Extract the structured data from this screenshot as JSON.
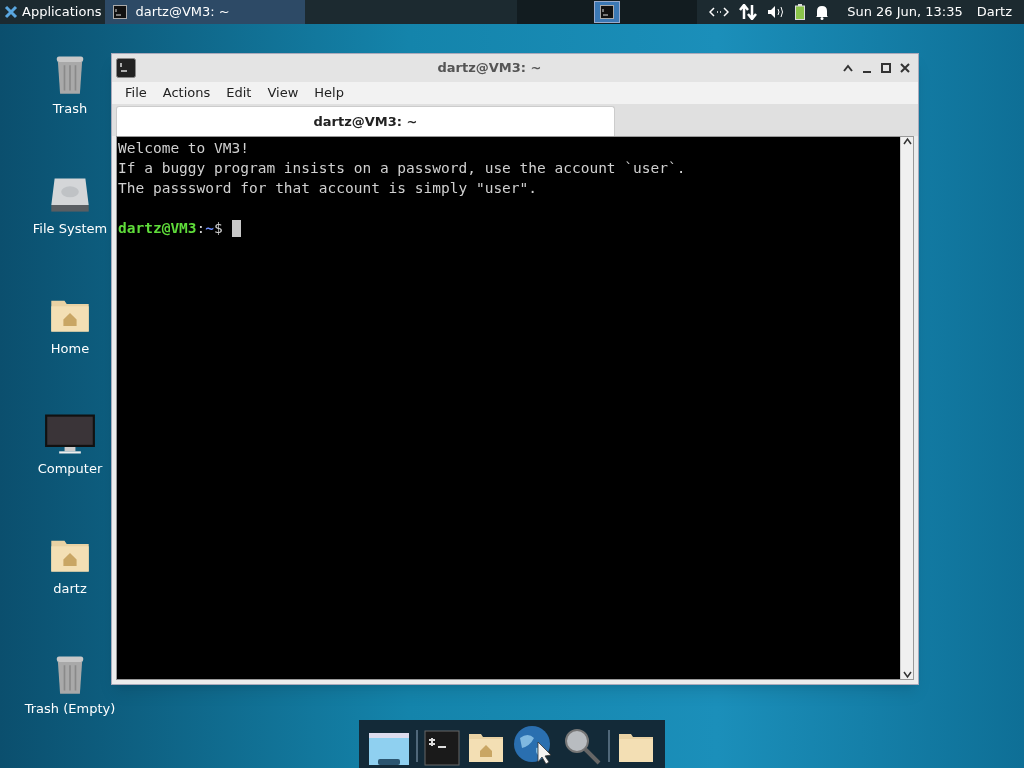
{
  "top_panel": {
    "applications": "Applications",
    "tasks": [
      {
        "title": "dartz@VM3: ~",
        "selected": true
      }
    ],
    "clock": "Sun 26 Jun, 13:35",
    "user": "Dartz"
  },
  "desktop_icons": [
    {
      "label": "Trash",
      "kind": "trash"
    },
    {
      "label": "File System",
      "kind": "drive"
    },
    {
      "label": "Home",
      "kind": "home"
    },
    {
      "label": "Computer",
      "kind": "computer"
    },
    {
      "label": "dartz",
      "kind": "home"
    },
    {
      "label": "Trash (Empty)",
      "kind": "trash"
    }
  ],
  "window": {
    "title": "dartz@VM3: ~",
    "menu": [
      "File",
      "Actions",
      "Edit",
      "View",
      "Help"
    ],
    "tabs": [
      {
        "label": "dartz@VM3: ~",
        "selected": true
      }
    ],
    "lines": [
      "Welcome to VM3!",
      "If a buggy program insists on a password, use the account `user`.",
      "The passsword for that account is simply \"user\"."
    ],
    "prompt": {
      "user_host": "dartz@VM3",
      "separator": ":",
      "path": "~",
      "symbol": "$"
    }
  },
  "dock": [
    {
      "kind": "desktop"
    },
    {
      "kind": "separator"
    },
    {
      "kind": "terminal"
    },
    {
      "kind": "home"
    },
    {
      "kind": "globe"
    },
    {
      "kind": "search"
    },
    {
      "kind": "separator"
    },
    {
      "kind": "folder"
    }
  ]
}
